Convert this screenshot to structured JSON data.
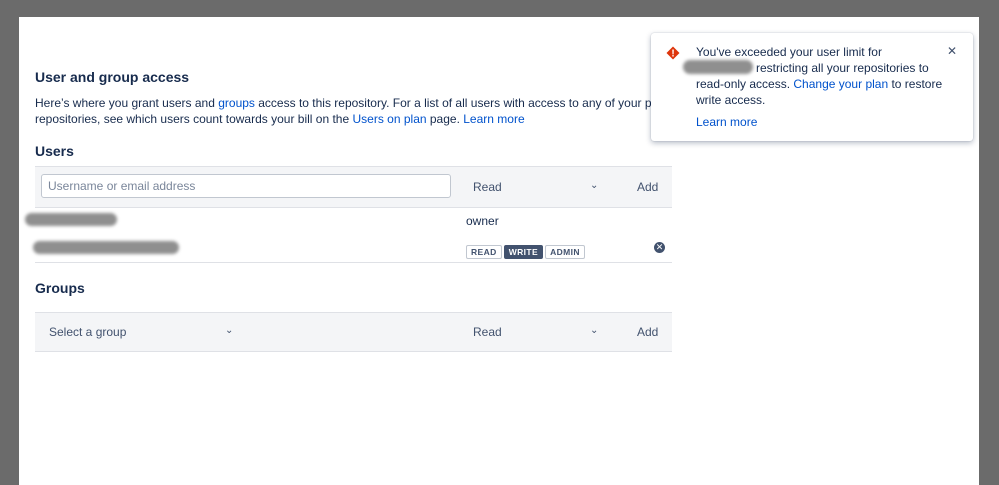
{
  "access": {
    "title": "User and group access",
    "description": {
      "part1": "Here’s where you grant users and ",
      "groups_link": "groups",
      "part2": " access to this repository. For a list of all users with access to any of your privat",
      "part3": "repositories, see which users count towards your bill on the ",
      "users_on_plan_link": "Users on plan",
      "part4": " page. ",
      "learn_more_link": "Learn more"
    }
  },
  "users": {
    "heading": "Users",
    "input_placeholder": "Username or email address",
    "permission_select": "Read",
    "add_label": "Add",
    "owner_label": "owner",
    "permissions": [
      "READ",
      "WRITE",
      "ADMIN"
    ],
    "active_permission": "WRITE"
  },
  "groups": {
    "heading": "Groups",
    "group_select_placeholder": "Select a group",
    "permission_select": "Read",
    "add_label": "Add"
  },
  "notification": {
    "line1": "You've exceeded your user limit for",
    "line2_tail": "restricting all your repositories to",
    "line3_head": "read-only access. ",
    "change_plan_link": "Change your plan",
    "line3_tail": " to restore",
    "line4": "write access.",
    "learn_more_link": "Learn more",
    "close_symbol": "✕",
    "warning_symbol": "!"
  },
  "colors": {
    "link": "#0052cc",
    "warning": "#de350b",
    "active_permission_bg": "#42526e"
  }
}
